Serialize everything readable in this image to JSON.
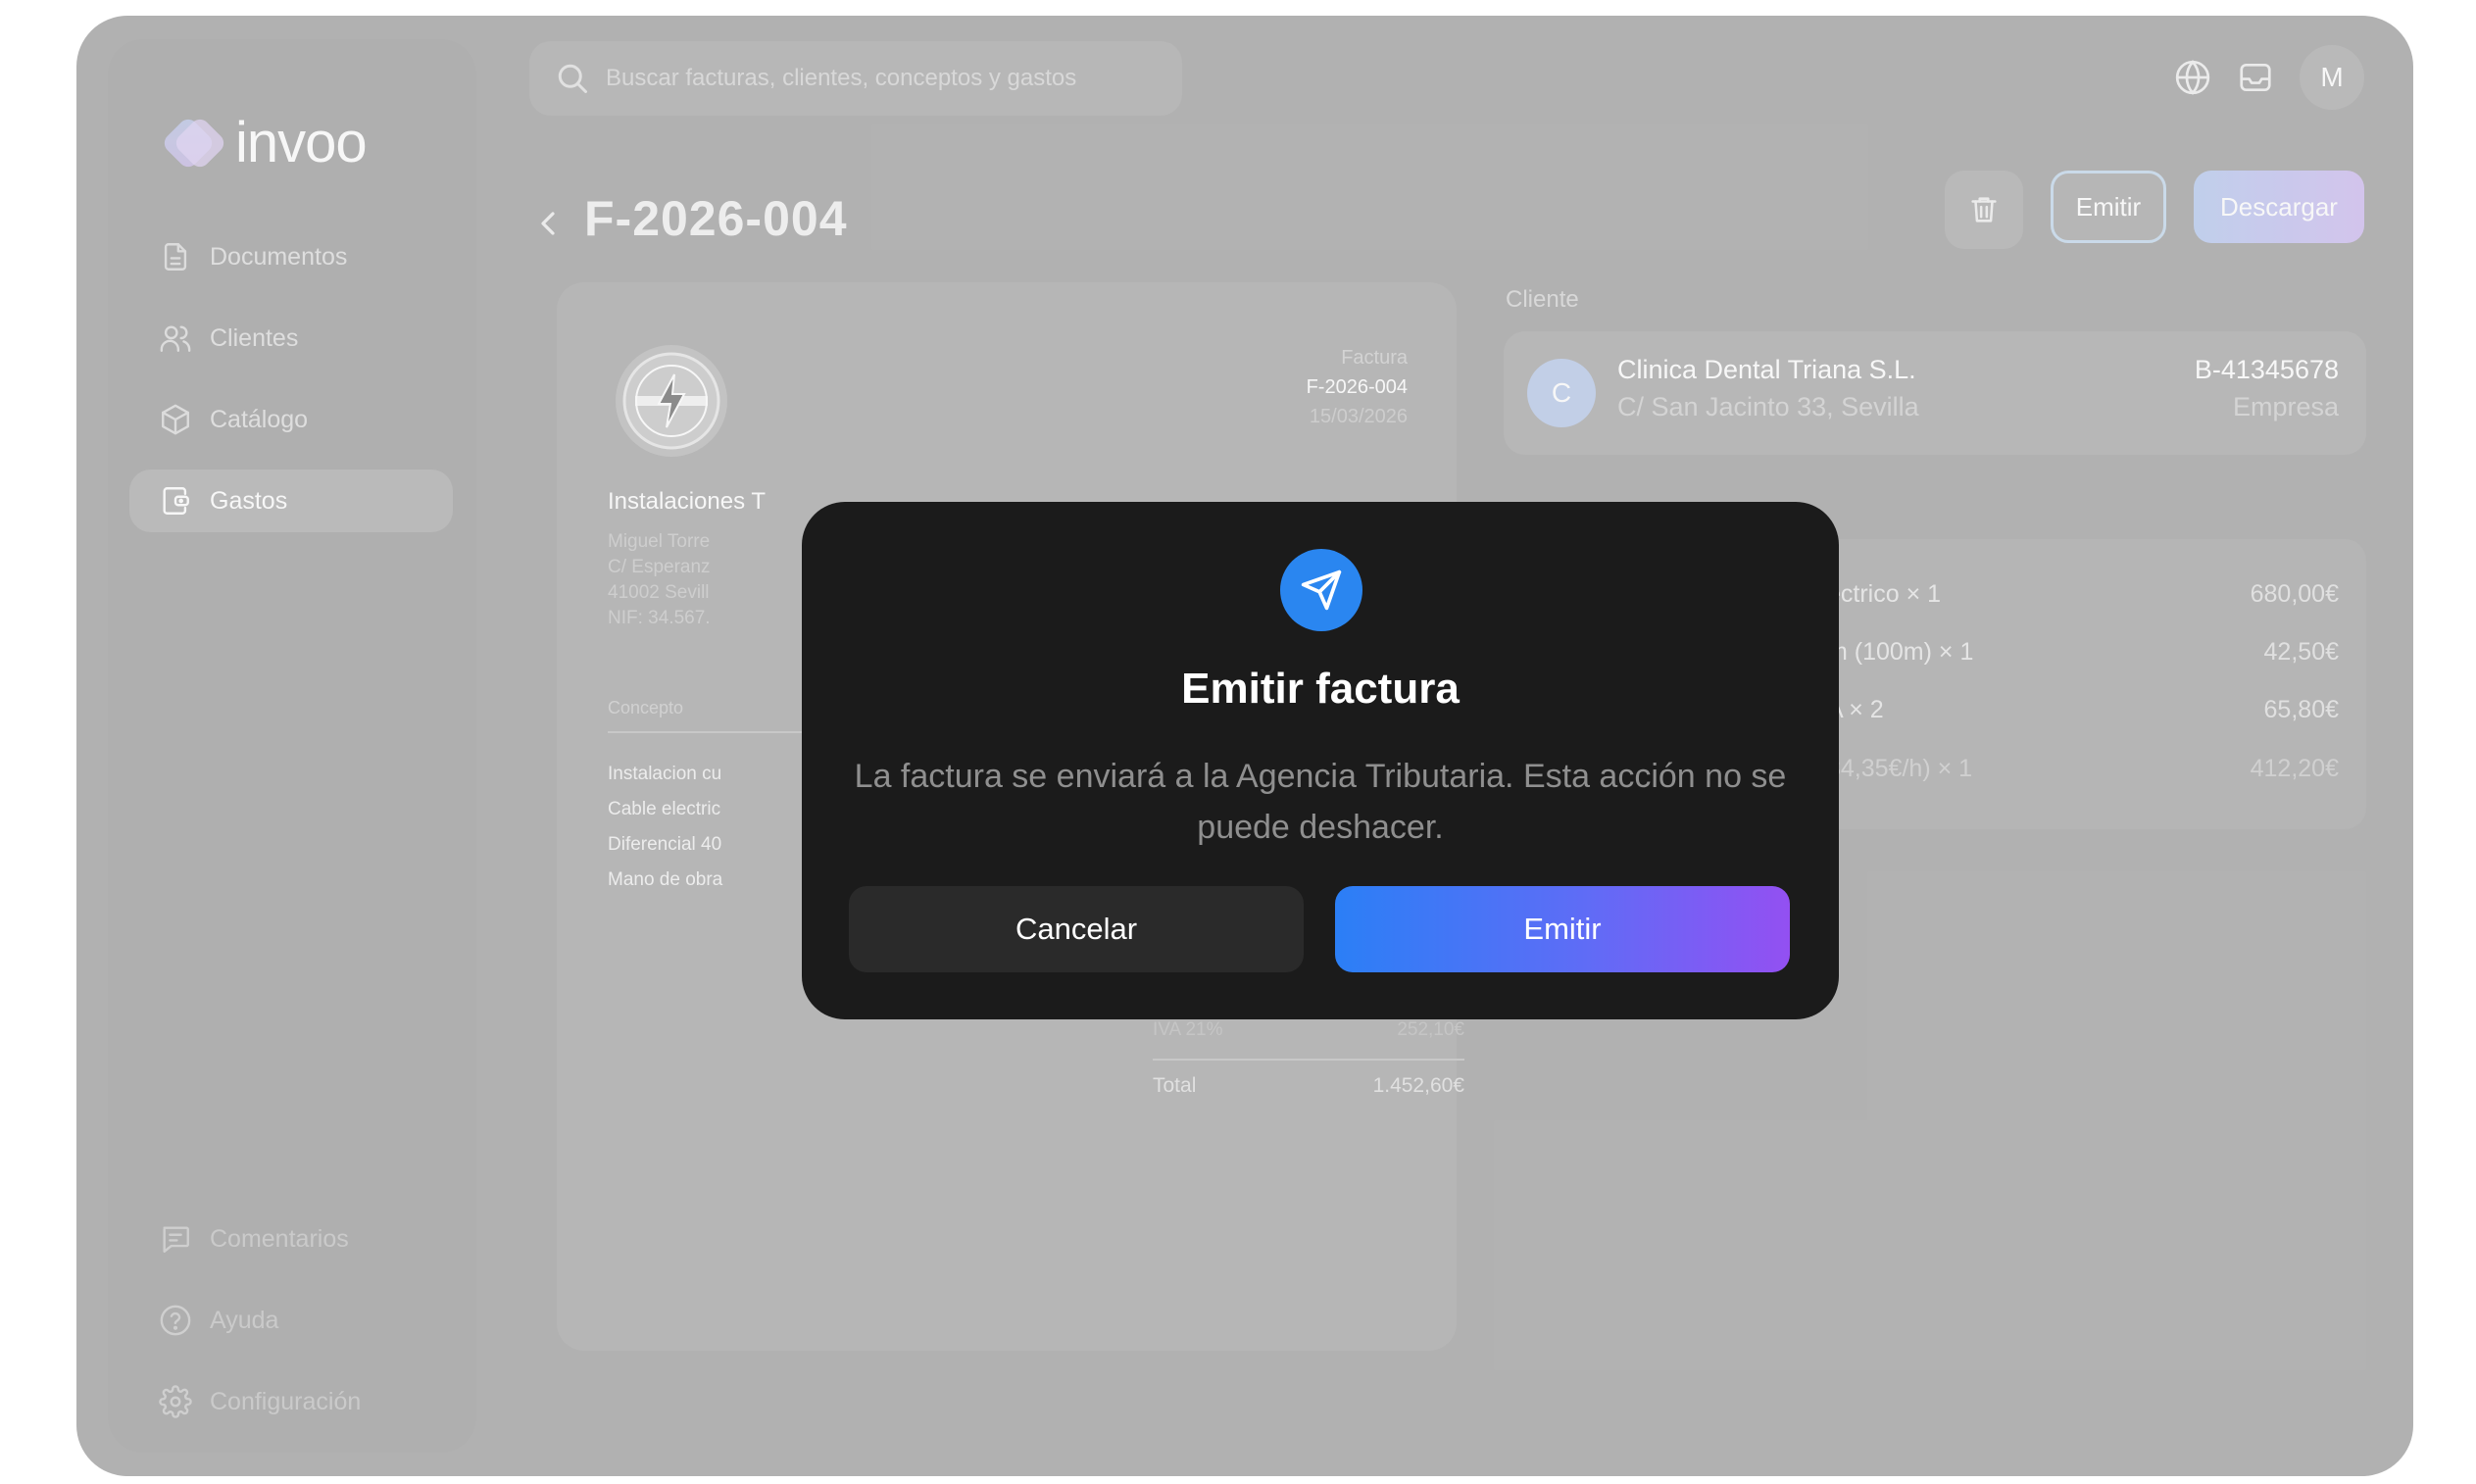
{
  "app": {
    "name": "invoo"
  },
  "sidebar": {
    "items": [
      {
        "label": "Documentos",
        "icon": "document-icon"
      },
      {
        "label": "Clientes",
        "icon": "users-icon"
      },
      {
        "label": "Catálogo",
        "icon": "box-icon"
      },
      {
        "label": "Gastos",
        "icon": "wallet-icon",
        "active": true
      }
    ],
    "bottom_items": [
      {
        "label": "Comentarios",
        "icon": "comment-icon"
      },
      {
        "label": "Ayuda",
        "icon": "help-icon"
      },
      {
        "label": "Configuración",
        "icon": "settings-icon"
      }
    ]
  },
  "search": {
    "placeholder": "Buscar facturas, clientes, conceptos y gastos"
  },
  "topbar": {
    "avatar_initial": "M"
  },
  "header": {
    "title": "F-2026-004",
    "emit_label": "Emitir",
    "download_label": "Descargar"
  },
  "invoice": {
    "type_label": "Factura",
    "number": "F-2026-004",
    "date": "15/03/2026",
    "issuer_name": "Instalaciones T",
    "issuer_lines": [
      "Miguel Torre",
      "C/ Esperanz",
      "41002 Sevill",
      "NIF: 34.567."
    ],
    "concept_header": "Concepto",
    "lines": [
      "Instalacion cu",
      "Cable electric",
      "Diferencial 40",
      "Mano de obra"
    ],
    "iva_label": "IVA 21%",
    "iva_value": "252,10€",
    "total_label": "Total",
    "total_value": "1.452,60€"
  },
  "client_panel": {
    "section_label": "Cliente",
    "avatar_initial": "C",
    "name": "Clinica Dental Triana S.L.",
    "address": "C/ San Jacinto 33, Sevilla",
    "nif": "B-41345678",
    "type": "Empresa"
  },
  "line_items": [
    {
      "desc": "ectrico × 1",
      "amount": "680,00€"
    },
    {
      "desc": "m (100m) × 1",
      "amount": "42,50€"
    },
    {
      "desc": "A × 2",
      "amount": "65,80€"
    },
    {
      "desc": "34,35€/h) × 1",
      "amount": "412,20€"
    }
  ],
  "modal": {
    "title": "Emitir factura",
    "body": "La factura se enviará a la Agencia Tributaria. Esta acción no se puede deshacer.",
    "cancel_label": "Cancelar",
    "confirm_label": "Emitir",
    "icon": "send-icon"
  },
  "colors": {
    "accent": "#2a86f0",
    "gradient_start": "#2b7ff6",
    "gradient_end": "#9350f2",
    "modal_bg": "#1b1b1b"
  }
}
